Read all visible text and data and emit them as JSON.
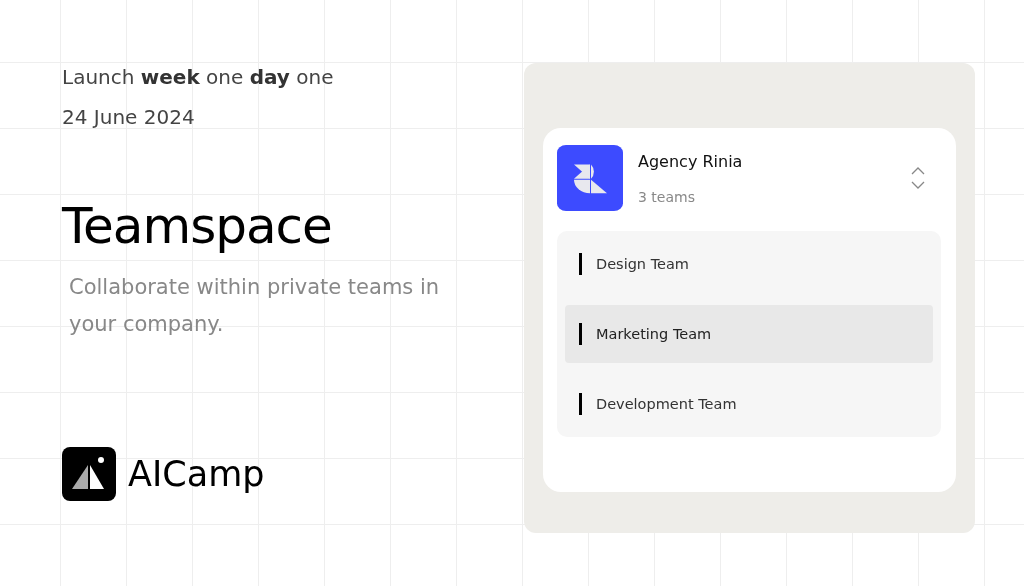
{
  "headline": "Launch **week** one **day** one",
  "date": "24 June 2024",
  "title": "Teamspace",
  "subtitle": "Collaborate within private teams in your company.",
  "brand": "AICamp",
  "workspace": {
    "name": "Agency Rinia",
    "count": "3 teams"
  },
  "teams": [
    {
      "label": "Design Team",
      "selected": false
    },
    {
      "label": "Marketing Team",
      "selected": true
    },
    {
      "label": "Development Team",
      "selected": false
    }
  ]
}
